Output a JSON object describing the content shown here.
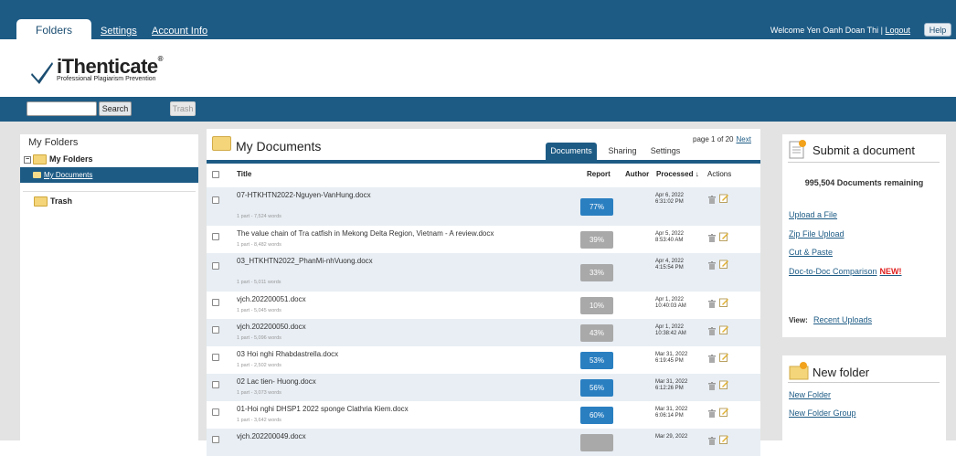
{
  "topbar": {
    "tab_folders": "Folders",
    "link_settings": "Settings",
    "link_account": "Account Info",
    "welcome": "Welcome Yen Oanh Doan Thi | ",
    "logout": "Logout",
    "help": "Help"
  },
  "logo": {
    "brand": "iThenticate",
    "reg": "®",
    "tagline": "Professional Plagiarism Prevention"
  },
  "nav": {
    "search_button": "Search",
    "trash_button": "Trash",
    "search_value": ""
  },
  "sidebar": {
    "title": "My Folders",
    "root": "My Folders",
    "selected": "My Documents",
    "trash": "Trash"
  },
  "main": {
    "title": "My Documents",
    "tabs": [
      "Documents",
      "Sharing",
      "Settings"
    ],
    "page_info": "page 1 of 20",
    "next": "Next",
    "columns": {
      "title": "Title",
      "report": "Report",
      "author": "Author",
      "processed": "Processed ↓",
      "actions": "Actions"
    },
    "rows": [
      {
        "title": "07-HTKHTN2022-Nguyen-VanHung.docx",
        "sub": "1 part - 7,524 words",
        "report": "77%",
        "color": "#2a7fc1",
        "date1": "Apr 6, 2022",
        "date2": "6:31:02 PM"
      },
      {
        "title": "The value chain of Tra catfish in Mekong Delta Region, Vietnam - A review.docx",
        "sub": "1 part - 8,482 words",
        "report": "39%",
        "color": "#a9a9a9",
        "date1": "Apr 5, 2022",
        "date2": "8:53:40 AM"
      },
      {
        "title": "03_HTKHTN2022_PhanMi-nhVuong.docx",
        "sub": "1 part - 5,011 words",
        "report": "33%",
        "color": "#a9a9a9",
        "date1": "Apr 4, 2022",
        "date2": "4:15:54 PM"
      },
      {
        "title": "vjch.202200051.docx",
        "sub": "1 part - 5,045 words",
        "report": "10%",
        "color": "#a9a9a9",
        "date1": "Apr 1, 2022",
        "date2": "10:40:03 AM"
      },
      {
        "title": "vjch.202200050.docx",
        "sub": "1 part - 5,096 words",
        "report": "43%",
        "color": "#a9a9a9",
        "date1": "Apr 1, 2022",
        "date2": "10:38:42 AM"
      },
      {
        "title": "03 Hoi nghi Rhabdastrella.docx",
        "sub": "1 part - 2,502 words",
        "report": "53%",
        "color": "#2a7fc1",
        "date1": "Mar 31, 2022",
        "date2": "6:19:45 PM"
      },
      {
        "title": "02 Lac tien- Huong.docx",
        "sub": "1 part - 3,073 words",
        "report": "56%",
        "color": "#2a7fc1",
        "date1": "Mar 31, 2022",
        "date2": "6:12:26 PM"
      },
      {
        "title": "01-Hoi nghi DHSP1 2022 sponge Clathria Kiem.docx",
        "sub": "1 part - 3,642 words",
        "report": "60%",
        "color": "#2a7fc1",
        "date1": "Mar 31, 2022",
        "date2": "6:06:14 PM"
      },
      {
        "title": "vjch.202200049.docx",
        "sub": "",
        "report": "",
        "color": "#a9a9a9",
        "date1": "Mar 29, 2022",
        "date2": ""
      }
    ]
  },
  "submit": {
    "title": "Submit a document",
    "remaining": "995,504 Documents remaining",
    "upload_file": "Upload a File",
    "zip_upload": "Zip File Upload",
    "cut_paste": "Cut & Paste",
    "doc_compare": "Doc-to-Doc Comparison",
    "new_badge": "NEW!",
    "view_label": "View:",
    "recent": "Recent Uploads"
  },
  "newfolder": {
    "title": "New folder",
    "new_folder": "New Folder",
    "new_group": "New Folder Group"
  },
  "colors": {
    "brand_blue": "#1d5b85",
    "report_blue": "#2a7fc1",
    "report_gray": "#a9a9a9",
    "background": "#e3e3e3"
  }
}
